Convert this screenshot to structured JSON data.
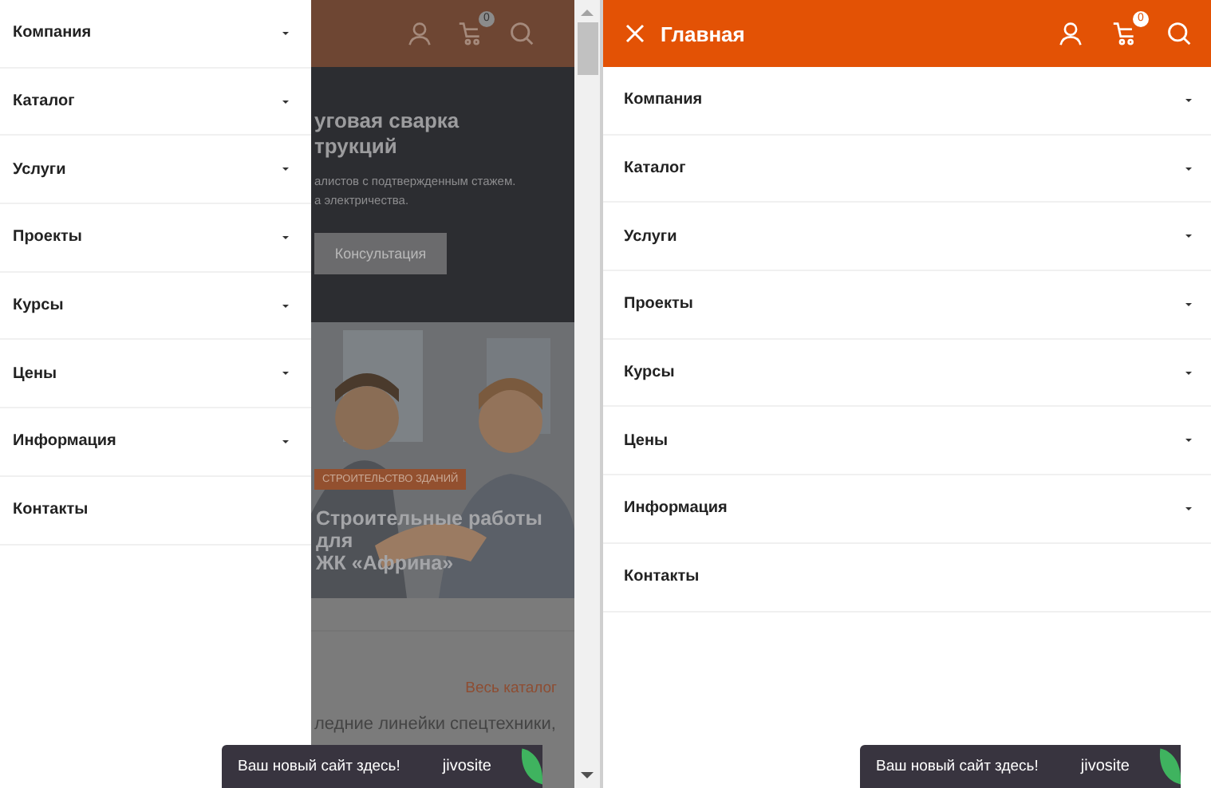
{
  "left_pane": {
    "menu": [
      {
        "label": "Компания",
        "expandable": true
      },
      {
        "label": "Каталог",
        "expandable": true
      },
      {
        "label": "Услуги",
        "expandable": true
      },
      {
        "label": "Проекты",
        "expandable": true
      },
      {
        "label": "Курсы",
        "expandable": true
      },
      {
        "label": "Цены",
        "expandable": true
      },
      {
        "label": "Информация",
        "expandable": true
      },
      {
        "label": "Контакты",
        "expandable": false
      }
    ],
    "page": {
      "cart_count": "0",
      "hero_title_lines": [
        "уговая сварка",
        "трукций"
      ],
      "hero_text_lines": [
        "алистов с подтвержденным стажем.",
        "а электричества."
      ],
      "hero_button": "Консультация",
      "card_tag": "СТРОИТЕЛЬСТВО ЗДАНИЙ",
      "card_title_lines": [
        "Строительные работы",
        "для",
        "ЖК «Африна»"
      ],
      "catalog_link": "Весь каталог",
      "body_text": "ледние линейки спецтехники,"
    },
    "chat_widget": {
      "text": "Ваш новый сайт здесь!",
      "brand": "jivosite"
    }
  },
  "right_pane": {
    "header": {
      "title": "Главная",
      "cart_count": "0"
    },
    "menu": [
      {
        "label": "Компания",
        "expandable": true
      },
      {
        "label": "Каталог",
        "expandable": true
      },
      {
        "label": "Услуги",
        "expandable": true
      },
      {
        "label": "Проекты",
        "expandable": true
      },
      {
        "label": "Курсы",
        "expandable": true
      },
      {
        "label": "Цены",
        "expandable": true
      },
      {
        "label": "Информация",
        "expandable": true
      },
      {
        "label": "Контакты",
        "expandable": false
      }
    ],
    "chat_widget": {
      "text": "Ваш новый сайт здесь!",
      "brand": "jivosite"
    }
  }
}
